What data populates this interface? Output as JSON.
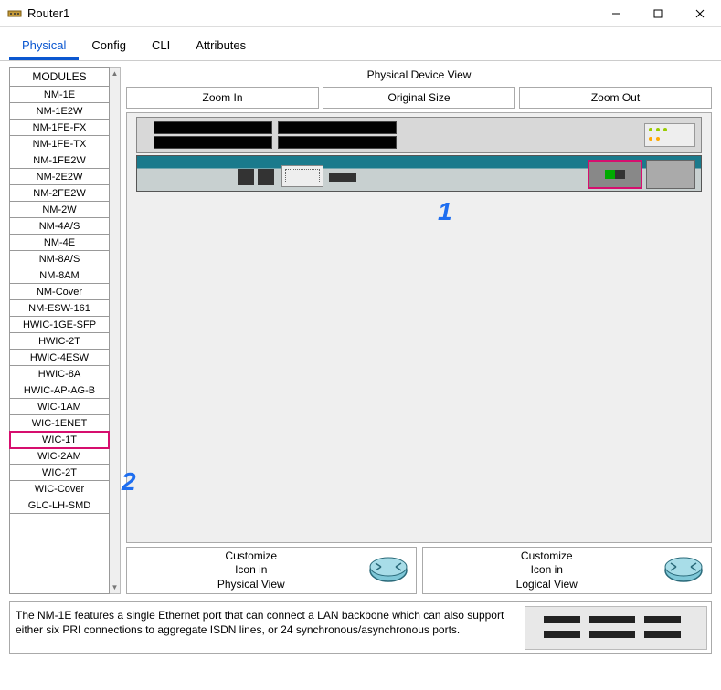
{
  "window": {
    "title": "Router1"
  },
  "tabs": [
    {
      "label": "Physical",
      "active": true
    },
    {
      "label": "Config"
    },
    {
      "label": "CLI"
    },
    {
      "label": "Attributes"
    }
  ],
  "modules": {
    "header": "MODULES",
    "items": [
      "NM-1E",
      "NM-1E2W",
      "NM-1FE-FX",
      "NM-1FE-TX",
      "NM-1FE2W",
      "NM-2E2W",
      "NM-2FE2W",
      "NM-2W",
      "NM-4A/S",
      "NM-4E",
      "NM-8A/S",
      "NM-8AM",
      "NM-Cover",
      "NM-ESW-161",
      "HWIC-1GE-SFP",
      "HWIC-2T",
      "HWIC-4ESW",
      "HWIC-8A",
      "HWIC-AP-AG-B",
      "WIC-1AM",
      "WIC-1ENET",
      "WIC-1T",
      "WIC-2AM",
      "WIC-2T",
      "WIC-Cover",
      "GLC-LH-SMD"
    ],
    "selected": "WIC-1T"
  },
  "deviceView": {
    "title": "Physical Device View",
    "zoomIn": "Zoom In",
    "originalSize": "Original Size",
    "zoomOut": "Zoom Out"
  },
  "customize": {
    "physical": "Customize\nIcon in\nPhysical View",
    "logical": "Customize\nIcon in\nLogical View"
  },
  "description": "The NM-1E features a single Ethernet port that can connect a LAN backbone which can also support either six PRI connections to aggregate ISDN lines, or 24 synchronous/asynchronous ports.",
  "annotations": {
    "one": "1",
    "two": "2"
  },
  "colors": {
    "accent": "#0b57d0",
    "highlight": "#d60e6e",
    "anno": "#1e6ef0",
    "teal": "#1a7a8c"
  }
}
